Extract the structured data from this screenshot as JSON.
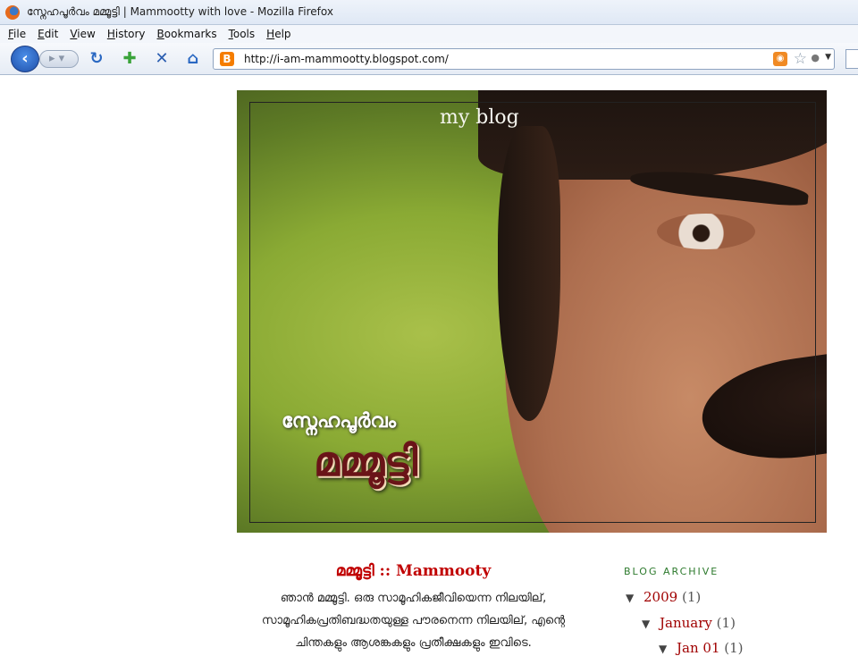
{
  "window": {
    "title": "സ്നേഹപൂർവം മമ്മൂട്ടി | Mammootty with love - Mozilla Firefox"
  },
  "menu": [
    "File",
    "Edit",
    "View",
    "History",
    "Bookmarks",
    "Tools",
    "Help"
  ],
  "toolbar": {
    "url": "http://i-am-mammootty.blogspot.com/",
    "icons": [
      "back-icon",
      "forward-icon",
      "reload-icon",
      "new-tab-icon",
      "stop-icon",
      "home-icon",
      "rss-icon",
      "bookmark-star-icon"
    ]
  },
  "header": {
    "label": "my blog",
    "subtitle_ml": "സ്നേഹപൂർവം",
    "name_ml": "മമ്മൂട്ടി"
  },
  "post": {
    "title": "മമ്മൂട്ടി :: Mammooty",
    "lines": [
      "ഞാൻ മമ്മൂട്ടി. ഒരു സാമൂഹികജീവിയെന്ന നിലയില്,",
      "സാമൂഹികപ്രതിബദ്ധതയുള്ള പൗരനെന്ന നിലയില്, എന്റെ",
      "ചിന്തകളും ആശങ്കകളും പ്രതീക്ഷകളും ഇവിടെ."
    ]
  },
  "sidebar": {
    "heading": "BLOG ARCHIVE",
    "archive": [
      {
        "label": "2009",
        "count": "(1)"
      },
      {
        "label": "January",
        "count": "(1)"
      },
      {
        "label": "Jan 01",
        "count": "(1)"
      }
    ]
  },
  "colors": {
    "link": "#a00000",
    "post_title": "#c00000",
    "archive_heading": "#2d7a2d"
  }
}
